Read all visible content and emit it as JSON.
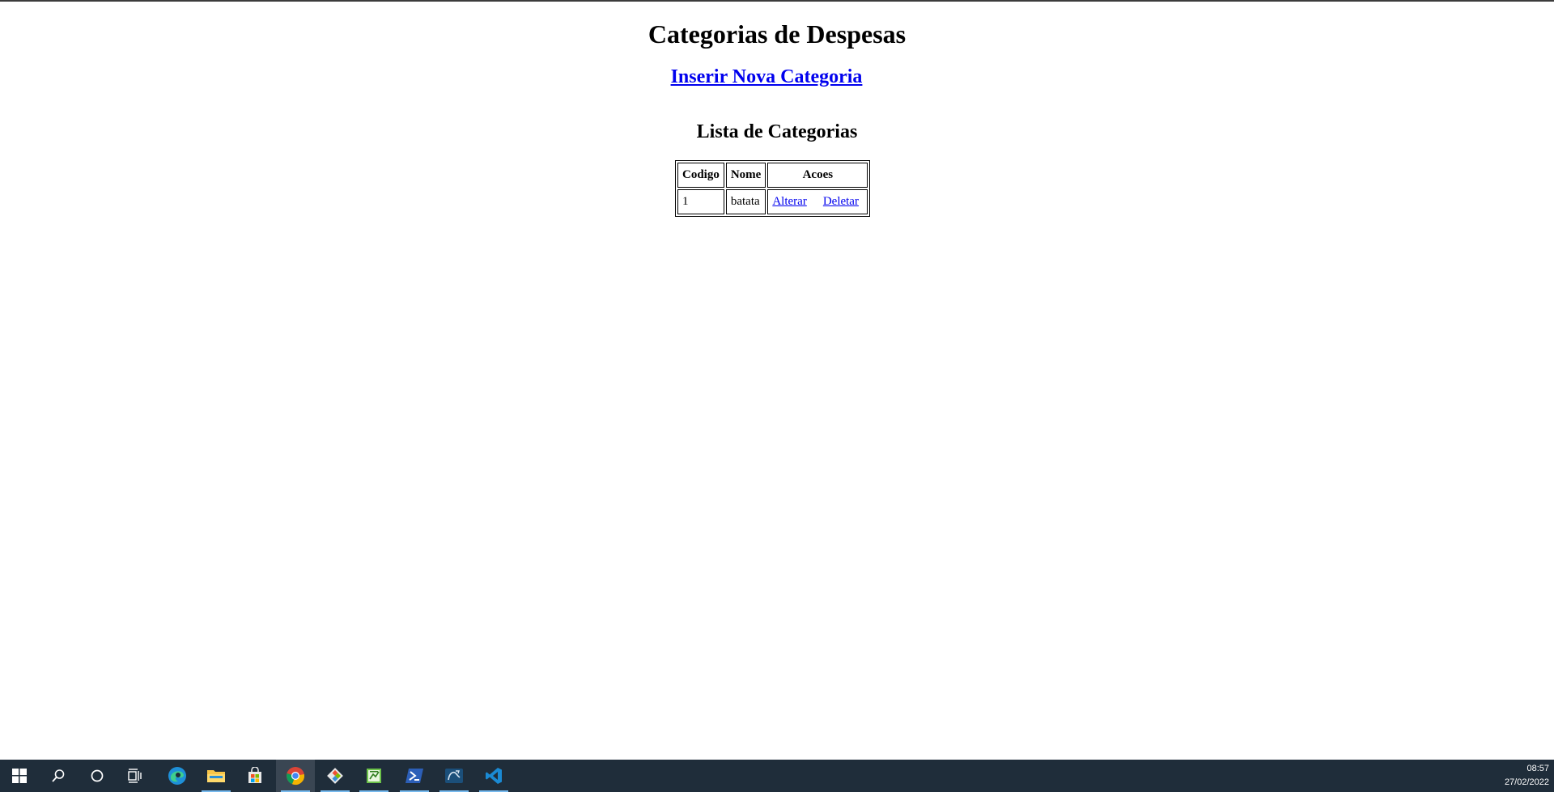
{
  "page": {
    "title": "Categorias de Despesas",
    "new_link": "Inserir Nova Categoria",
    "list_title": "Lista de Categorias"
  },
  "table": {
    "headers": [
      "Codigo",
      "Nome",
      "Acoes"
    ],
    "rows": [
      {
        "codigo": "1",
        "nome": "batata",
        "alterar": "Alterar",
        "deletar": "Deletar"
      }
    ]
  },
  "taskbar": {
    "icons": [
      "windows-start-icon",
      "search-icon",
      "cortana-icon",
      "task-view-icon",
      "edge-icon",
      "file-explorer-icon",
      "store-icon",
      "chrome-icon",
      "git-icon",
      "notepad-icon",
      "powershell-icon",
      "mysql-workbench-icon",
      "vscode-icon"
    ],
    "time": "08:57",
    "date": "27/02/2022"
  },
  "colors": {
    "link": "#0000ee",
    "taskbar": "#1f2d3a",
    "running_indicator": "#76b9ed"
  }
}
